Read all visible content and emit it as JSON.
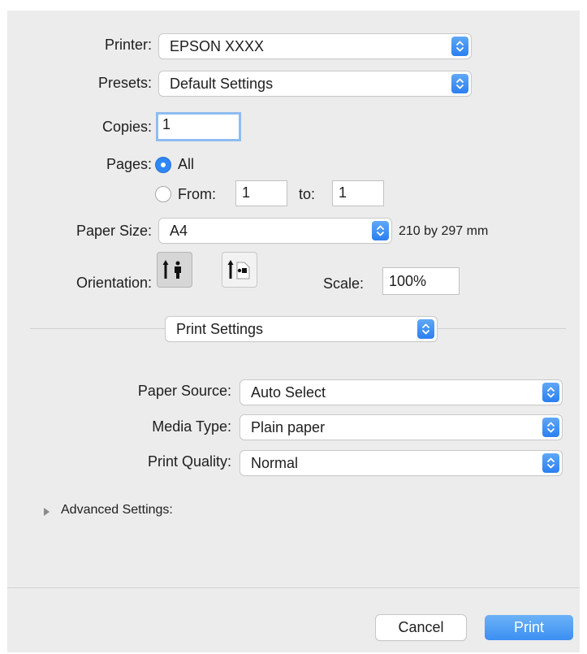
{
  "printer": {
    "label": "Printer:",
    "value": "EPSON XXXX"
  },
  "presets": {
    "label": "Presets:",
    "value": "Default Settings"
  },
  "copies": {
    "label": "Copies:",
    "value": "1"
  },
  "pages": {
    "label": "Pages:",
    "all_label": "All",
    "from_label": "From:",
    "from_value": "1",
    "to_label": "to:",
    "to_value": "1",
    "selected": "All"
  },
  "paper_size": {
    "label": "Paper Size:",
    "value": "A4",
    "dimensions": "210 by 297 mm"
  },
  "orientation": {
    "label": "Orientation:",
    "selected": "portrait"
  },
  "scale": {
    "label": "Scale:",
    "value": "100%"
  },
  "section_popup": {
    "value": "Print Settings"
  },
  "print_settings": {
    "paper_source": {
      "label": "Paper Source:",
      "value": "Auto Select"
    },
    "media_type": {
      "label": "Media Type:",
      "value": "Plain paper"
    },
    "print_quality": {
      "label": "Print Quality:",
      "value": "Normal"
    }
  },
  "advanced": {
    "label": "Advanced Settings:",
    "expanded": false
  },
  "buttons": {
    "cancel": "Cancel",
    "print": "Print"
  },
  "colors": {
    "accent": "#2f86f6",
    "background": "#ececec"
  }
}
